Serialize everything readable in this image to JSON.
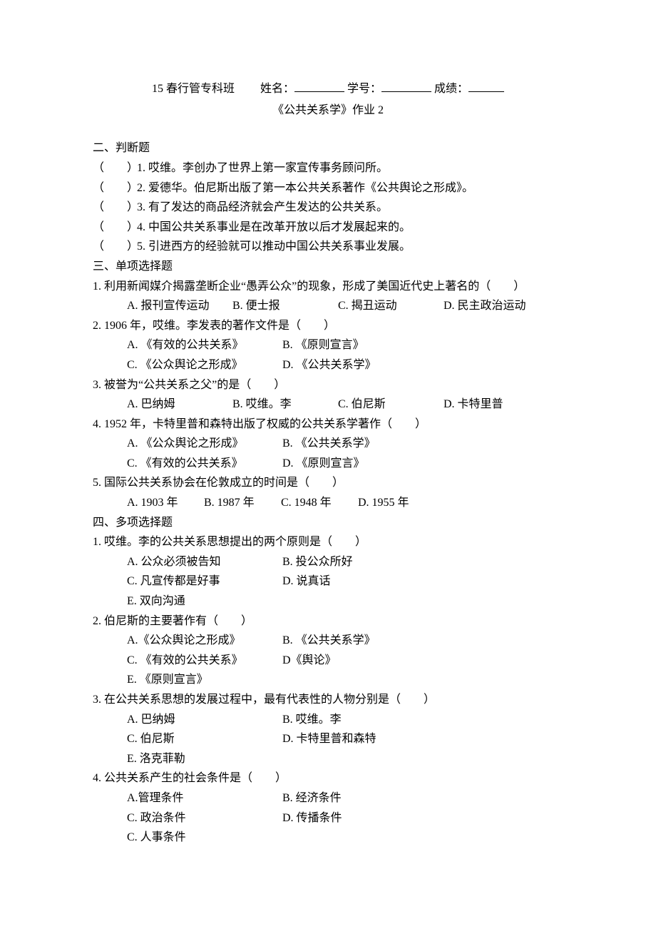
{
  "header": {
    "class_label": "15 春行管专科班",
    "name_label": "姓名：",
    "id_label": "学号：",
    "score_label": "成绩：",
    "title": "《公共关系学》作业 2"
  },
  "section2": {
    "title": "二、判断题",
    "paren": "（　　）",
    "items": [
      "1. 哎维。李创办了世界上第一家宣传事务顾问所。",
      "2. 爱德华。伯尼斯出版了第一本公共关系著作《公共舆论之形成》。",
      "3. 有了发达的商品经济就会产生发达的公共关系。",
      "4. 中国公共关系事业是在改革开放以后才发展起来的。",
      "5. 引进西方的经验就可以推动中国公共关系事业发展。"
    ]
  },
  "section3": {
    "title": "三、单项选择题",
    "questions": [
      {
        "stem": "1. 利用新闻媒介揭露垄断企业“愚弄公众”的现象，形成了美国近代史上著名的（　　）",
        "opts": [
          "A. 报刊宣传运动",
          "B. 便士报",
          "C. 揭丑运动",
          "D. 民主政治运动"
        ],
        "layout": "four-col"
      },
      {
        "stem": "2. 1906 年，哎维。李发表的著作文件是（　　）",
        "opts_rows": [
          [
            "A. 《有效的公共关系》",
            "B. 《原则宣言》"
          ],
          [
            "C. 《公众舆论之形成》",
            "D. 《公共关系学》"
          ]
        ],
        "layout": "two-col"
      },
      {
        "stem": "3. 被誉为“公共关系之父”的是（　　）",
        "opts": [
          "A. 巴纳姆",
          "B. 哎维。李",
          "C. 伯尼斯",
          "D. 卡特里普"
        ],
        "layout": "four-col tight2"
      },
      {
        "stem": "4. 1952 年，卡特里普和森特出版了权威的公共关系学著作（　　）",
        "opts_rows": [
          [
            "A. 《公众舆论之形成》",
            "B. 《公共关系学》"
          ],
          [
            "C. 《有效的公共关系》",
            "D. 《原则宣言》"
          ]
        ],
        "layout": "two-col"
      },
      {
        "stem": "5. 国际公共关系协会在伦敦成立的时间是（　　）",
        "opts": [
          "A. 1903 年",
          "B. 1987 年",
          "C. 1948 年",
          "D. 1955 年"
        ],
        "layout": "four-col tight"
      }
    ]
  },
  "section4": {
    "title": "四、多项选择题",
    "questions": [
      {
        "stem": "1. 哎维。李的公共关系思想提出的两个原则是（　　）",
        "opts_rows": [
          [
            "A. 公众必须被告知",
            "B. 投公众所好"
          ],
          [
            "C. 凡宣传都是好事",
            "D. 说真话"
          ],
          [
            "E. 双向沟通"
          ]
        ]
      },
      {
        "stem": "2. 伯尼斯的主要著作有（　　）",
        "opts_rows": [
          [
            "A.《公众舆论之形成》",
            "B. 《公共关系学》"
          ],
          [
            "C. 《有效的公共关系》",
            "D《舆论》"
          ],
          [
            "E. 《原则宣言》"
          ]
        ]
      },
      {
        "stem": "3. 在公共关系思想的发展过程中，最有代表性的人物分别是（　　）",
        "opts_rows": [
          [
            "A. 巴纳姆",
            "B. 哎维。李"
          ],
          [
            "C. 伯尼斯",
            "D. 卡特里普和森特"
          ],
          [
            "E. 洛克菲勒"
          ]
        ]
      },
      {
        "stem": "4. 公共关系产生的社会条件是（　　）",
        "opts_rows": [
          [
            "A.管理条件",
            "B. 经济条件"
          ],
          [
            "C. 政治条件",
            "D. 传播条件"
          ],
          [
            "C. 人事条件"
          ]
        ]
      }
    ]
  }
}
